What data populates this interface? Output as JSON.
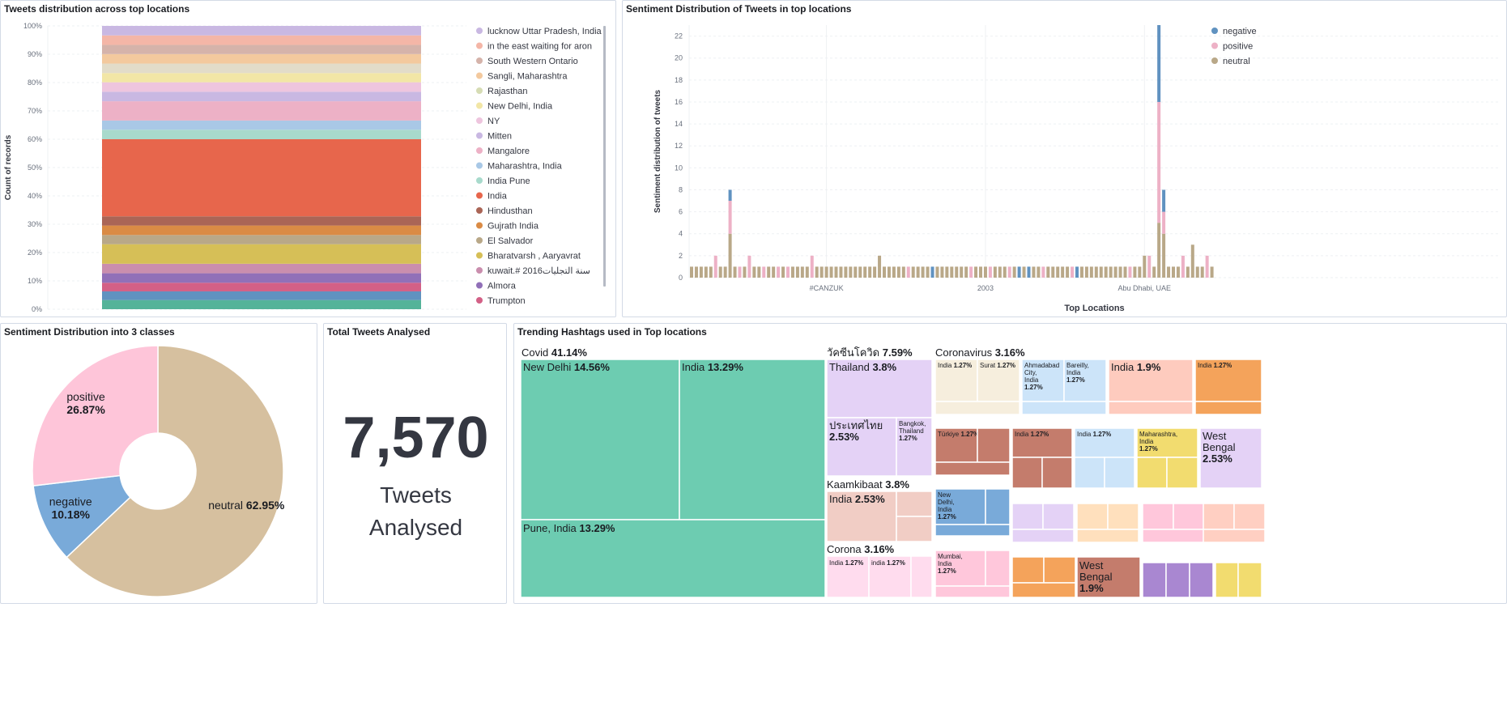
{
  "panels": {
    "stacked": {
      "title": "Tweets distribution across top locations"
    },
    "sentiment_bars": {
      "title": "Sentiment Distribution of Tweets in top locations"
    },
    "donut": {
      "title": "Sentiment Distribution into 3 classes"
    },
    "metric": {
      "title": "Total Tweets Analysed",
      "value": "7,570",
      "label_line1": "Tweets",
      "label_line2": "Analysed"
    },
    "treemap": {
      "title": "Trending Hashtags used in Top locations"
    }
  },
  "chart_data": [
    {
      "type": "bar",
      "stacked": "percent",
      "ylabel": "Count of records",
      "yticks": [
        "0%",
        "10%",
        "20%",
        "30%",
        "40%",
        "50%",
        "60%",
        "70%",
        "80%",
        "90%",
        "100%"
      ],
      "ylim": [
        0,
        100
      ],
      "segments": [
        {
          "name": "",
          "value": 3.2,
          "color": "#54b399"
        },
        {
          "name": "",
          "value": 3.0,
          "color": "#6092c0"
        },
        {
          "name": "Trumpton",
          "value": 3.0,
          "color": "#d36086"
        },
        {
          "name": "Almora",
          "value": 3.3,
          "color": "#9170b8"
        },
        {
          "name": "kuwait.# 2016سنة التجليات",
          "value": 3.3,
          "color": "#ca8eae"
        },
        {
          "name": "Bharatvarsh , Aaryavrat",
          "value": 6.8,
          "color": "#d6bf57"
        },
        {
          "name": "El Salvador",
          "value": 3.2,
          "color": "#b9a888"
        },
        {
          "name": "Gujrath India",
          "value": 3.3,
          "color": "#da8b45"
        },
        {
          "name": "Hindusthan",
          "value": 3.2,
          "color": "#aa6556"
        },
        {
          "name": "India",
          "value": 26.8,
          "color": "#e7664c"
        },
        {
          "name": "India Pune",
          "value": 3.3,
          "color": "#a8dacc"
        },
        {
          "name": "Maharashtra, India",
          "value": 3.2,
          "color": "#a9c8e6"
        },
        {
          "name": "Mangalore",
          "value": 6.7,
          "color": "#edb1c6"
        },
        {
          "name": "Mitten",
          "value": 3.3,
          "color": "#c9b8e2"
        },
        {
          "name": "NY",
          "value": 3.3,
          "color": "#eec5de"
        },
        {
          "name": "New Delhi, India",
          "value": 3.2,
          "color": "#f2e6a6"
        },
        {
          "name": "Rajasthan",
          "value": 3.3,
          "color": "#e2dcc9"
        },
        {
          "name": "Sangli, Maharashtra",
          "value": 3.3,
          "color": "#f3c99e"
        },
        {
          "name": "South Western Ontario",
          "value": 3.2,
          "color": "#d5b3aa"
        },
        {
          "name": "in the east waiting for aron",
          "value": 3.3,
          "color": "#f4b6a7"
        },
        {
          "name": "lucknow Uttar Pradesh, India",
          "value": 3.3,
          "color": "#c9b8e2"
        }
      ],
      "legend": [
        {
          "name": "lucknow Uttar Pradesh, India",
          "color": "#c9b8e2"
        },
        {
          "name": "in the east waiting for aron",
          "color": "#f4b6a7"
        },
        {
          "name": "South Western Ontario",
          "color": "#d5b3aa"
        },
        {
          "name": "Sangli, Maharashtra",
          "color": "#f3c99e"
        },
        {
          "name": "Rajasthan",
          "color": "#d6dcb4"
        },
        {
          "name": "New Delhi, India",
          "color": "#f2e6a6"
        },
        {
          "name": "NY",
          "color": "#eec5de"
        },
        {
          "name": "Mitten",
          "color": "#c9b8e2"
        },
        {
          "name": "Mangalore",
          "color": "#edb1c6"
        },
        {
          "name": "Maharashtra, India",
          "color": "#a9c8e6"
        },
        {
          "name": "India Pune",
          "color": "#a8dacc"
        },
        {
          "name": "India",
          "color": "#e7664c"
        },
        {
          "name": "Hindusthan",
          "color": "#aa6556"
        },
        {
          "name": "Gujrath India",
          "color": "#da8b45"
        },
        {
          "name": "El Salvador",
          "color": "#b9a888"
        },
        {
          "name": "Bharatvarsh , Aaryavrat",
          "color": "#d6bf57"
        },
        {
          "name": "kuwait.# 2016سنة التجليات",
          "color": "#ca8eae"
        },
        {
          "name": "Almora",
          "color": "#9170b8"
        },
        {
          "name": "Trumpton",
          "color": "#d36086"
        }
      ]
    },
    {
      "type": "bar",
      "stacked": "count",
      "xlabel": "Top Locations",
      "ylabel": "Sentiment distribution of tweets",
      "ylim": [
        0,
        23
      ],
      "yticks": [
        0,
        2,
        4,
        6,
        8,
        10,
        12,
        14,
        16,
        18,
        20,
        22
      ],
      "xtick_labels": [
        {
          "index": 28,
          "label": "#CANZUK"
        },
        {
          "index": 61,
          "label": "2003"
        },
        {
          "index": 94,
          "label": "Abu Dhabi, UAE"
        }
      ],
      "legend": [
        {
          "name": "negative",
          "color": "#6092c0"
        },
        {
          "name": "positive",
          "color": "#edb1c6"
        },
        {
          "name": "neutral",
          "color": "#b9a888"
        }
      ],
      "series_order": [
        "neutral",
        "positive",
        "negative"
      ],
      "bar_count": 109,
      "bars": [
        [
          1,
          0,
          0
        ],
        [
          1,
          0,
          0
        ],
        [
          1,
          0,
          0
        ],
        [
          1,
          0,
          0
        ],
        [
          1,
          0,
          0
        ],
        [
          0,
          2,
          0
        ],
        [
          1,
          0,
          0
        ],
        [
          1,
          0,
          0
        ],
        [
          4,
          3,
          1
        ],
        [
          1,
          0,
          0
        ],
        [
          0,
          1,
          0
        ],
        [
          1,
          0,
          0
        ],
        [
          0,
          2,
          0
        ],
        [
          1,
          0,
          0
        ],
        [
          1,
          0,
          0
        ],
        [
          0,
          1,
          0
        ],
        [
          1,
          0,
          0
        ],
        [
          1,
          0,
          0
        ],
        [
          0,
          1,
          0
        ],
        [
          1,
          0,
          0
        ],
        [
          0,
          1,
          0
        ],
        [
          1,
          0,
          0
        ],
        [
          1,
          0,
          0
        ],
        [
          1,
          0,
          0
        ],
        [
          1,
          0,
          0
        ],
        [
          0,
          2,
          0
        ],
        [
          1,
          0,
          0
        ],
        [
          1,
          0,
          0
        ],
        [
          1,
          0,
          0
        ],
        [
          1,
          0,
          0
        ],
        [
          1,
          0,
          0
        ],
        [
          1,
          0,
          0
        ],
        [
          1,
          0,
          0
        ],
        [
          1,
          0,
          0
        ],
        [
          1,
          0,
          0
        ],
        [
          1,
          0,
          0
        ],
        [
          1,
          0,
          0
        ],
        [
          1,
          0,
          0
        ],
        [
          1,
          0,
          0
        ],
        [
          2,
          0,
          0
        ],
        [
          1,
          0,
          0
        ],
        [
          1,
          0,
          0
        ],
        [
          1,
          0,
          0
        ],
        [
          1,
          0,
          0
        ],
        [
          1,
          0,
          0
        ],
        [
          0,
          1,
          0
        ],
        [
          1,
          0,
          0
        ],
        [
          1,
          0,
          0
        ],
        [
          1,
          0,
          0
        ],
        [
          1,
          0,
          0
        ],
        [
          0,
          0,
          1
        ],
        [
          1,
          0,
          0
        ],
        [
          1,
          0,
          0
        ],
        [
          1,
          0,
          0
        ],
        [
          1,
          0,
          0
        ],
        [
          1,
          0,
          0
        ],
        [
          1,
          0,
          0
        ],
        [
          1,
          0,
          0
        ],
        [
          0,
          1,
          0
        ],
        [
          1,
          0,
          0
        ],
        [
          1,
          0,
          0
        ],
        [
          1,
          0,
          0
        ],
        [
          0,
          1,
          0
        ],
        [
          1,
          0,
          0
        ],
        [
          1,
          0,
          0
        ],
        [
          1,
          0,
          0
        ],
        [
          0,
          1,
          0
        ],
        [
          1,
          0,
          0
        ],
        [
          0,
          0,
          1
        ],
        [
          1,
          0,
          0
        ],
        [
          0,
          0,
          1
        ],
        [
          1,
          0,
          0
        ],
        [
          1,
          0,
          0
        ],
        [
          0,
          1,
          0
        ],
        [
          1,
          0,
          0
        ],
        [
          1,
          0,
          0
        ],
        [
          1,
          0,
          0
        ],
        [
          1,
          0,
          0
        ],
        [
          1,
          0,
          0
        ],
        [
          0,
          1,
          0
        ],
        [
          0,
          0,
          1
        ],
        [
          1,
          0,
          0
        ],
        [
          1,
          0,
          0
        ],
        [
          1,
          0,
          0
        ],
        [
          1,
          0,
          0
        ],
        [
          1,
          0,
          0
        ],
        [
          1,
          0,
          0
        ],
        [
          1,
          0,
          0
        ],
        [
          1,
          0,
          0
        ],
        [
          1,
          0,
          0
        ],
        [
          1,
          0,
          0
        ],
        [
          0,
          1,
          0
        ],
        [
          1,
          0,
          0
        ],
        [
          1,
          0,
          0
        ],
        [
          2,
          0,
          0
        ],
        [
          0,
          2,
          0
        ],
        [
          1,
          0,
          0
        ],
        [
          5,
          11,
          7
        ],
        [
          4,
          2,
          2
        ],
        [
          1,
          0,
          0
        ],
        [
          1,
          0,
          0
        ],
        [
          1,
          0,
          0
        ],
        [
          0,
          2,
          0
        ],
        [
          1,
          0,
          0
        ],
        [
          3,
          0,
          0
        ],
        [
          1,
          0,
          0
        ],
        [
          1,
          0,
          0
        ],
        [
          0,
          2,
          0
        ],
        [
          1,
          0,
          0
        ]
      ]
    },
    {
      "type": "pie",
      "donut": true,
      "slices": [
        {
          "name": "neutral",
          "percent": "62.95%",
          "value": 62.95,
          "color": "#d6c09f"
        },
        {
          "name": "negative",
          "percent": "10.18%",
          "value": 10.18,
          "color": "#79aad9"
        },
        {
          "name": "positive",
          "percent": "26.87%",
          "value": 26.87,
          "color": "#fec5d9"
        }
      ]
    },
    {
      "type": "treemap",
      "groups": [
        {
          "label": "Covid",
          "pct": "41.14%",
          "color": "#6dccb1",
          "cells": [
            {
              "label": "New Delhi",
              "pct": "14.56%"
            },
            {
              "label": "India",
              "pct": "13.29%"
            },
            {
              "label": "Pune, India",
              "pct": "13.29%"
            }
          ]
        },
        {
          "label": "วัคซีนโควิด",
          "pct": "7.59%",
          "color": "#e4d2f6",
          "cells": [
            {
              "label": "Thailand",
              "pct": "3.8%"
            },
            {
              "label": "ประเทศไทย",
              "pct": "2.53%"
            },
            {
              "label": "Bangkok, Thailand",
              "pct": "1.27%"
            }
          ]
        },
        {
          "label": "Kaamkibaat",
          "pct": "3.8%",
          "color": "#f1cdc5",
          "cells": [
            {
              "label": "India",
              "pct": "2.53%"
            }
          ]
        },
        {
          "label": "Corona",
          "pct": "3.16%",
          "color": "#ffdcee",
          "cells": [
            {
              "label": "India",
              "pct": "1.27%"
            },
            {
              "label": "india",
              "pct": "1.27%"
            }
          ]
        },
        {
          "label": "Coronavirus",
          "pct": "3.16%",
          "color": "#f6eedd",
          "cells": [
            {
              "label": "India",
              "pct": "1.27%"
            },
            {
              "label": "Surat",
              "pct": "1.27%"
            }
          ]
        },
        {
          "label": "",
          "pct": "",
          "color": "#cce4f9",
          "cells": [
            {
              "label": "Ahmadabad City, India",
              "pct": "1.27%"
            },
            {
              "label": "Bareilly, India",
              "pct": "1.27%"
            }
          ]
        },
        {
          "label": "",
          "pct": "",
          "color": "#fecbbe",
          "cells": [
            {
              "label": "India",
              "pct": "1.9%"
            }
          ]
        },
        {
          "label": "",
          "pct": "",
          "color": "#f4a35b",
          "cells": [
            {
              "label": "India",
              "pct": "1.27%"
            }
          ]
        },
        {
          "label": "",
          "pct": "",
          "color": "#c47c6c",
          "cells": [
            {
              "label": "Türkiye",
              "pct": "1.27%"
            }
          ]
        },
        {
          "label": "",
          "pct": "",
          "color": "#c47c6c",
          "cells": [
            {
              "label": "India",
              "pct": "1.27%"
            }
          ]
        },
        {
          "label": "",
          "pct": "",
          "color": "#cce4f9",
          "cells": [
            {
              "label": "India",
              "pct": "1.27%"
            }
          ]
        },
        {
          "label": "",
          "pct": "",
          "color": "#f2dc6f",
          "cells": [
            {
              "label": "Maharashtra, India",
              "pct": "1.27%"
            }
          ]
        },
        {
          "label": "",
          "pct": "",
          "color": "#e4d2f6",
          "cells": [
            {
              "label": "West Bengal",
              "pct": "2.53%"
            }
          ]
        },
        {
          "label": "",
          "pct": "",
          "color": "#79aad9",
          "cells": [
            {
              "label": "New Delhi, India",
              "pct": "1.27%"
            }
          ]
        },
        {
          "label": "",
          "pct": "",
          "color": "#ffc7db",
          "cells": [
            {
              "label": "Mumbai, India",
              "pct": "1.27%"
            }
          ]
        },
        {
          "label": "",
          "pct": "",
          "color": "#c47c6c",
          "cells": [
            {
              "label": "West Bengal",
              "pct": "1.9%"
            }
          ]
        }
      ]
    }
  ]
}
